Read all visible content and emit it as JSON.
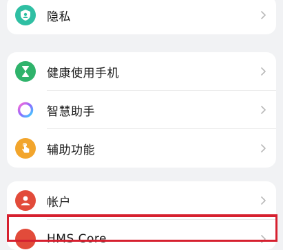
{
  "groups": [
    {
      "items": [
        {
          "label": "隐私",
          "icon": "shield-person-icon",
          "color": "#2fbfa3"
        }
      ]
    },
    {
      "items": [
        {
          "label": "健康使用手机",
          "icon": "hourglass-icon",
          "color": "#2fb36b"
        },
        {
          "label": "智慧助手",
          "icon": "assistant-ring-icon",
          "color": "#8c6bff"
        },
        {
          "label": "辅助功能",
          "icon": "hand-tap-icon",
          "color": "#f2a52c"
        }
      ]
    },
    {
      "items": [
        {
          "label": "帐户",
          "icon": "account-icon",
          "color": "#e24b3a"
        },
        {
          "label": "HMS Core",
          "icon": "hms-core-icon",
          "color": "#e24b3a"
        }
      ]
    }
  ],
  "highlight_color": "#d6202f"
}
